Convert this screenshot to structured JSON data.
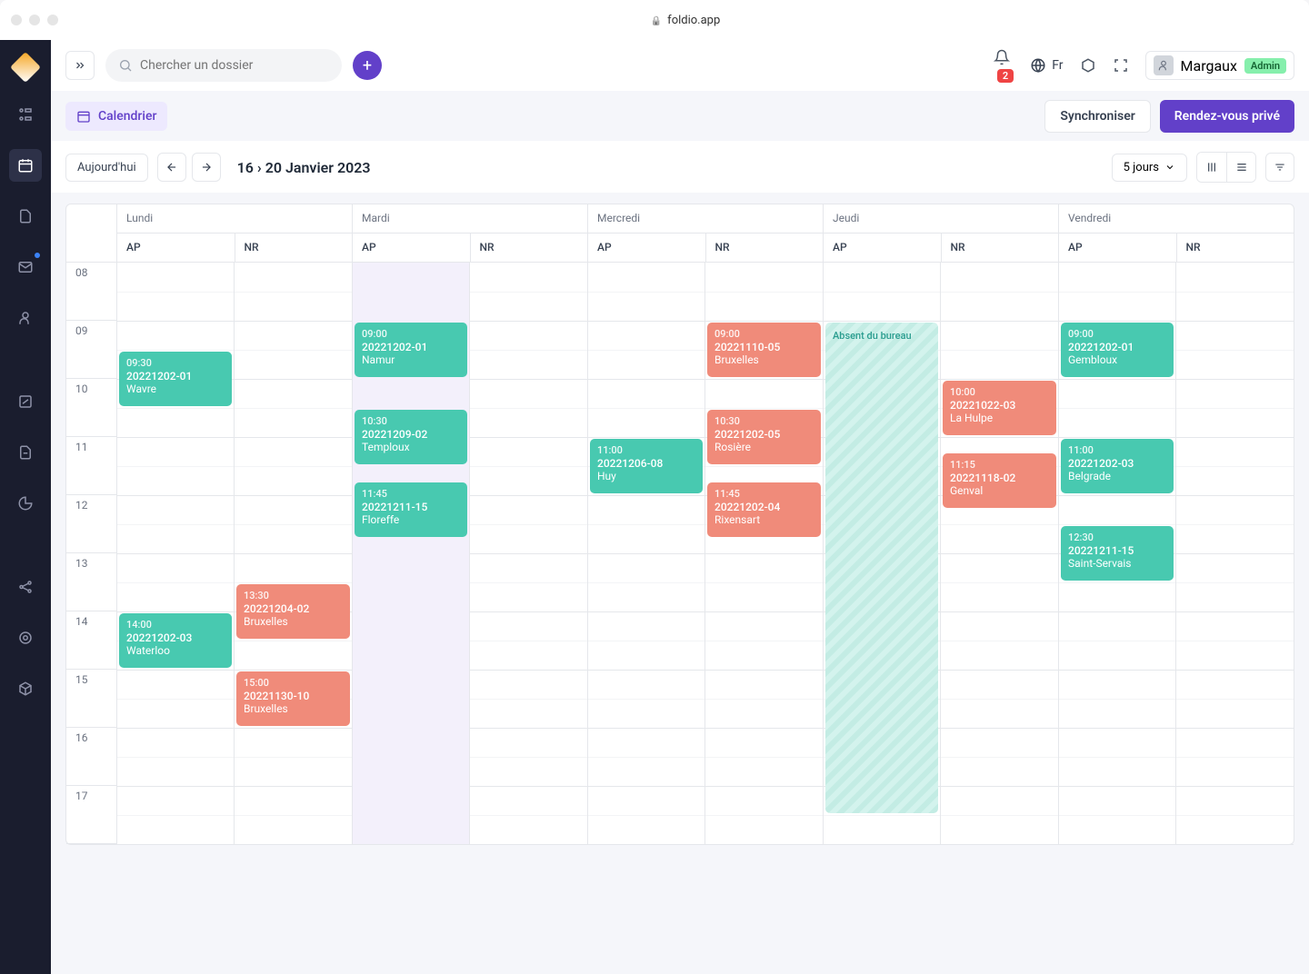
{
  "browser": {
    "url": "foldio.app"
  },
  "topbar": {
    "search_placeholder": "Chercher un dossier",
    "notif_count": "2",
    "lang": "Fr",
    "username": "Margaux",
    "role": "Admin"
  },
  "subheader": {
    "calendar_label": "Calendrier",
    "sync_label": "Synchroniser",
    "private_label": "Rendez-vous privé"
  },
  "toolbar": {
    "today_label": "Aujourd'hui",
    "date_range": "16 › 20 Janvier 2023",
    "view_select": "5 jours"
  },
  "calendar": {
    "hours": [
      "08",
      "09",
      "10",
      "11",
      "12",
      "13",
      "14",
      "15",
      "16",
      "17"
    ],
    "days": [
      {
        "label": "Lundi",
        "cols": [
          "AP",
          "NR"
        ]
      },
      {
        "label": "Mardi",
        "cols": [
          "AP",
          "NR"
        ]
      },
      {
        "label": "Mercredi",
        "cols": [
          "AP",
          "NR"
        ]
      },
      {
        "label": "Jeudi",
        "cols": [
          "AP",
          "NR"
        ]
      },
      {
        "label": "Vendredi",
        "cols": [
          "AP",
          "NR"
        ]
      }
    ],
    "absent_label": "Absent du bureau",
    "events": [
      {
        "day": 0,
        "col": 0,
        "start": 9.5,
        "end": 10.5,
        "time": "09:30",
        "title": "20221202-01",
        "loc": "Wavre",
        "color": "teal"
      },
      {
        "day": 0,
        "col": 0,
        "start": 14.0,
        "end": 15.0,
        "time": "14:00",
        "title": "20221202-03",
        "loc": "Waterloo",
        "color": "teal"
      },
      {
        "day": 0,
        "col": 1,
        "start": 13.5,
        "end": 14.5,
        "time": "13:30",
        "title": "20221204-02",
        "loc": "Bruxelles",
        "color": "coral"
      },
      {
        "day": 0,
        "col": 1,
        "start": 15.0,
        "end": 16.0,
        "time": "15:00",
        "title": "20221130-10",
        "loc": "Bruxelles",
        "color": "coral"
      },
      {
        "day": 1,
        "col": 0,
        "start": 9.0,
        "end": 10.0,
        "time": "09:00",
        "title": "20221202-01",
        "loc": "Namur",
        "color": "teal"
      },
      {
        "day": 1,
        "col": 0,
        "start": 10.5,
        "end": 11.5,
        "time": "10:30",
        "title": "20221209-02",
        "loc": "Temploux",
        "color": "teal"
      },
      {
        "day": 1,
        "col": 0,
        "start": 11.75,
        "end": 12.75,
        "time": "11:45",
        "title": "20221211-15",
        "loc": "Floreffe",
        "color": "teal"
      },
      {
        "day": 2,
        "col": 0,
        "start": 11.0,
        "end": 12.0,
        "time": "11:00",
        "title": "20221206-08",
        "loc": "Huy",
        "color": "teal"
      },
      {
        "day": 2,
        "col": 1,
        "start": 9.0,
        "end": 10.0,
        "time": "09:00",
        "title": "20221110-05",
        "loc": "Bruxelles",
        "color": "coral"
      },
      {
        "day": 2,
        "col": 1,
        "start": 10.5,
        "end": 11.5,
        "time": "10:30",
        "title": "20221202-05",
        "loc": "Rosière",
        "color": "coral"
      },
      {
        "day": 2,
        "col": 1,
        "start": 11.75,
        "end": 12.75,
        "time": "11:45",
        "title": "20221202-04",
        "loc": "Rixensart",
        "color": "coral"
      },
      {
        "day": 3,
        "col": 1,
        "start": 10.0,
        "end": 11.0,
        "time": "10:00",
        "title": "20221022-03",
        "loc": "La Hulpe",
        "color": "coral"
      },
      {
        "day": 3,
        "col": 1,
        "start": 11.25,
        "end": 12.25,
        "time": "11:15",
        "title": "20221118-02",
        "loc": "Genval",
        "color": "coral"
      },
      {
        "day": 4,
        "col": 0,
        "start": 9.0,
        "end": 10.0,
        "time": "09:00",
        "title": "20221202-01",
        "loc": "Gembloux",
        "color": "teal"
      },
      {
        "day": 4,
        "col": 0,
        "start": 11.0,
        "end": 12.0,
        "time": "11:00",
        "title": "20221202-03",
        "loc": "Belgrade",
        "color": "teal"
      },
      {
        "day": 4,
        "col": 0,
        "start": 12.5,
        "end": 13.5,
        "time": "12:30",
        "title": "20221211-15",
        "loc": "Saint-Servais",
        "color": "teal"
      }
    ],
    "absent": {
      "day": 3,
      "col": 0,
      "start": 9.0,
      "end": 17.5
    }
  }
}
